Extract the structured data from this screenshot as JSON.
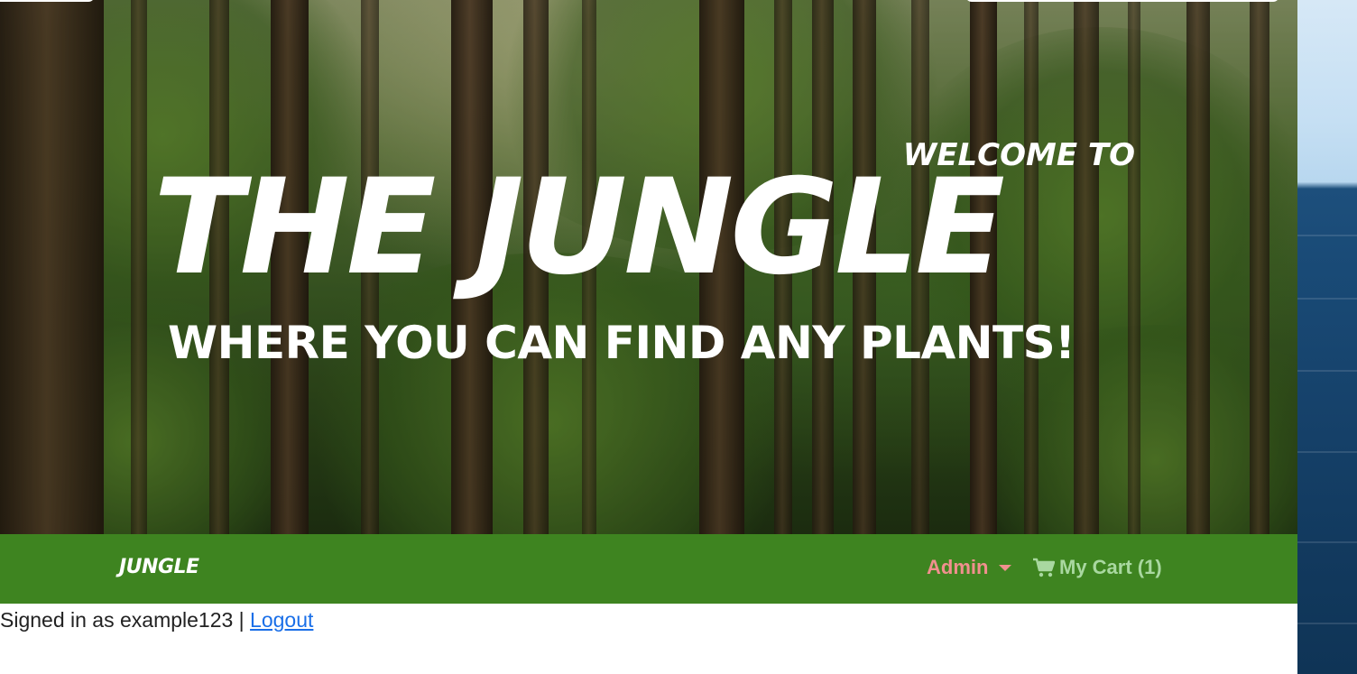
{
  "hero": {
    "welcome": "WELCOME TO",
    "title": "THE JUNGLE",
    "tagline": "WHERE YOU CAN FIND ANY PLANTS!"
  },
  "navbar": {
    "brand": "JUNGLE",
    "admin_label": "Admin",
    "cart_label": "My Cart (1)",
    "colors": {
      "background": "#3e8420",
      "admin": "#f0908e",
      "cart": "#a9d8a0"
    }
  },
  "session": {
    "signed_in_text": "Signed in as example123 |",
    "logout_label": "Logout"
  },
  "icons": {
    "cart": "shopping-cart-icon",
    "admin_dropdown": "caret-down-icon"
  }
}
